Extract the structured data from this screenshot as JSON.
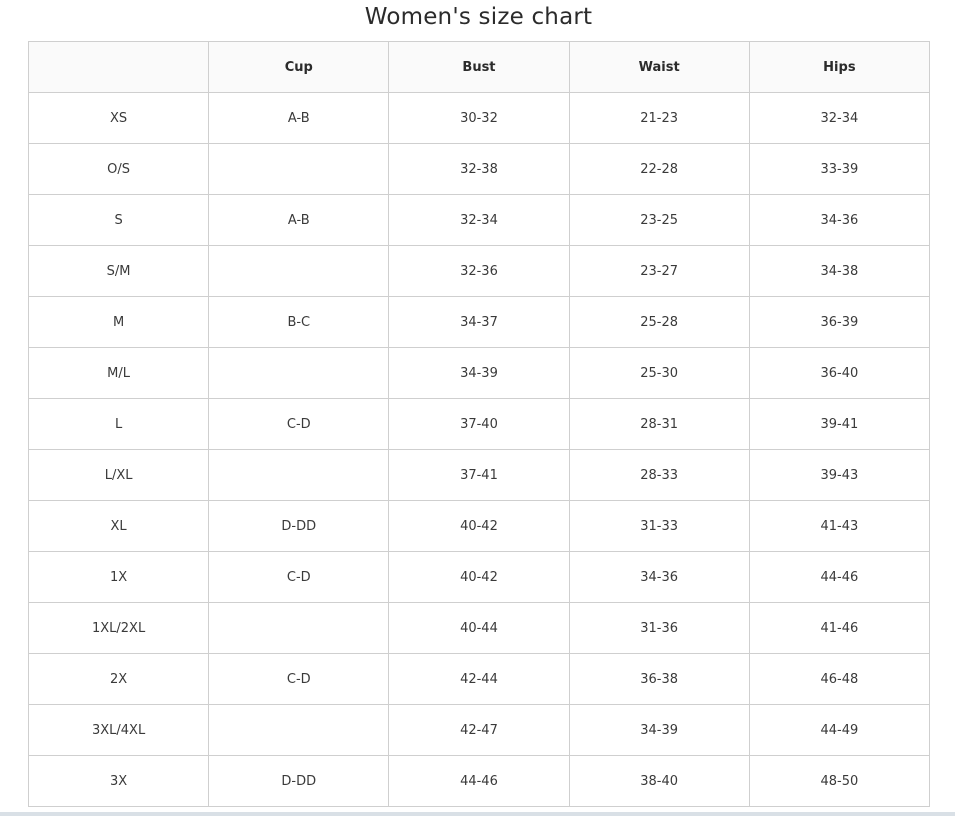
{
  "title": "Women's size chart",
  "table": {
    "headers": [
      "",
      "Cup",
      "Bust",
      "Waist",
      "Hips"
    ],
    "rows": [
      {
        "size": "XS",
        "cup": "A-B",
        "bust": "30-32",
        "waist": "21-23",
        "hips": "32-34"
      },
      {
        "size": "O/S",
        "cup": "",
        "bust": "32-38",
        "waist": "22-28",
        "hips": "33-39"
      },
      {
        "size": "S",
        "cup": "A-B",
        "bust": "32-34",
        "waist": "23-25",
        "hips": "34-36"
      },
      {
        "size": "S/M",
        "cup": "",
        "bust": "32-36",
        "waist": "23-27",
        "hips": "34-38"
      },
      {
        "size": "M",
        "cup": "B-C",
        "bust": "34-37",
        "waist": "25-28",
        "hips": "36-39"
      },
      {
        "size": "M/L",
        "cup": "",
        "bust": "34-39",
        "waist": "25-30",
        "hips": "36-40"
      },
      {
        "size": "L",
        "cup": "C-D",
        "bust": "37-40",
        "waist": "28-31",
        "hips": "39-41"
      },
      {
        "size": "L/XL",
        "cup": "",
        "bust": "37-41",
        "waist": "28-33",
        "hips": "39-43"
      },
      {
        "size": "XL",
        "cup": "D-DD",
        "bust": "40-42",
        "waist": "31-33",
        "hips": "41-43"
      },
      {
        "size": "1X",
        "cup": "C-D",
        "bust": "40-42",
        "waist": "34-36",
        "hips": "44-46"
      },
      {
        "size": "1XL/2XL",
        "cup": "",
        "bust": "40-44",
        "waist": "31-36",
        "hips": "41-46"
      },
      {
        "size": "2X",
        "cup": "C-D",
        "bust": "42-44",
        "waist": "36-38",
        "hips": "46-48"
      },
      {
        "size": "3XL/4XL",
        "cup": "",
        "bust": "42-47",
        "waist": "34-39",
        "hips": "44-49"
      },
      {
        "size": "3X",
        "cup": "D-DD",
        "bust": "44-46",
        "waist": "38-40",
        "hips": "48-50"
      }
    ]
  }
}
